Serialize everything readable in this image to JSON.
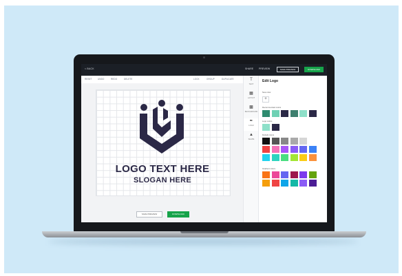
{
  "topbar": {
    "back_label": "< BACK",
    "share_label": "SHARE",
    "preview_label": "PREVIEW",
    "save_preview_label": "SAVE PREVIEW",
    "download_label": "DOWNLOAD"
  },
  "toolbar": {
    "reset": "RESET",
    "undo": "UNDO",
    "redo": "REDO",
    "delete": "DELETE",
    "lock": "LOCK",
    "group": "GROUP",
    "duplicate": "DUPLICATE"
  },
  "canvas": {
    "logo_text": "LOGO TEXT HERE",
    "slogan_text": "SLOGAN HERE",
    "logo_color": "#2b2846"
  },
  "bottom": {
    "save_preview_label": "SAVE PREVIEW",
    "download_label": "DOWNLOAD"
  },
  "rail": {
    "items": [
      {
        "label": "TEXT",
        "icon": "text-icon"
      },
      {
        "label": "LAYOUT",
        "icon": "layout-icon"
      },
      {
        "label": "BACKGROUND",
        "icon": "background-icon"
      },
      {
        "label": "LOGO",
        "icon": "logo-icon"
      },
      {
        "label": "SHAPE",
        "icon": "shape-icon"
      }
    ]
  },
  "panel": {
    "title": "Edit Logo",
    "new_color_label": "New color",
    "recommended_label": "Recommended colors",
    "logo_colors_label": "Logo colors",
    "default_colors_label": "Default colors",
    "gradient_colors_label": "Gradient colors",
    "recommended_colors": [
      "#2e8b6f",
      "#6fd1b4",
      "#2b2846",
      "#3d7f6e",
      "#8ee0c9",
      "#2b2846"
    ],
    "logo_colors": [
      "#8ee0c9",
      "#2b2846"
    ],
    "default_colors": [
      "#111111",
      "#555555",
      "#888888",
      "#aaaaaa",
      "#d6d6d6",
      "#ffffff",
      "#ef4444",
      "#f472b6",
      "#a855f7",
      "#8b5cf6",
      "#6366f1",
      "#3b82f6",
      "#22d3ee",
      "#2dd4bf",
      "#4ade80",
      "#a3e635",
      "#facc15",
      "#fb923c"
    ],
    "gradient_colors": [
      "#f97316",
      "#ec4899",
      "#6366f1",
      "#9d174d",
      "#7c3aed",
      "#65a30d",
      "#f59e0b",
      "#ef4444",
      "#0ea5e9",
      "#14b8a6",
      "#8b5cf6",
      "#4c1d95"
    ]
  }
}
